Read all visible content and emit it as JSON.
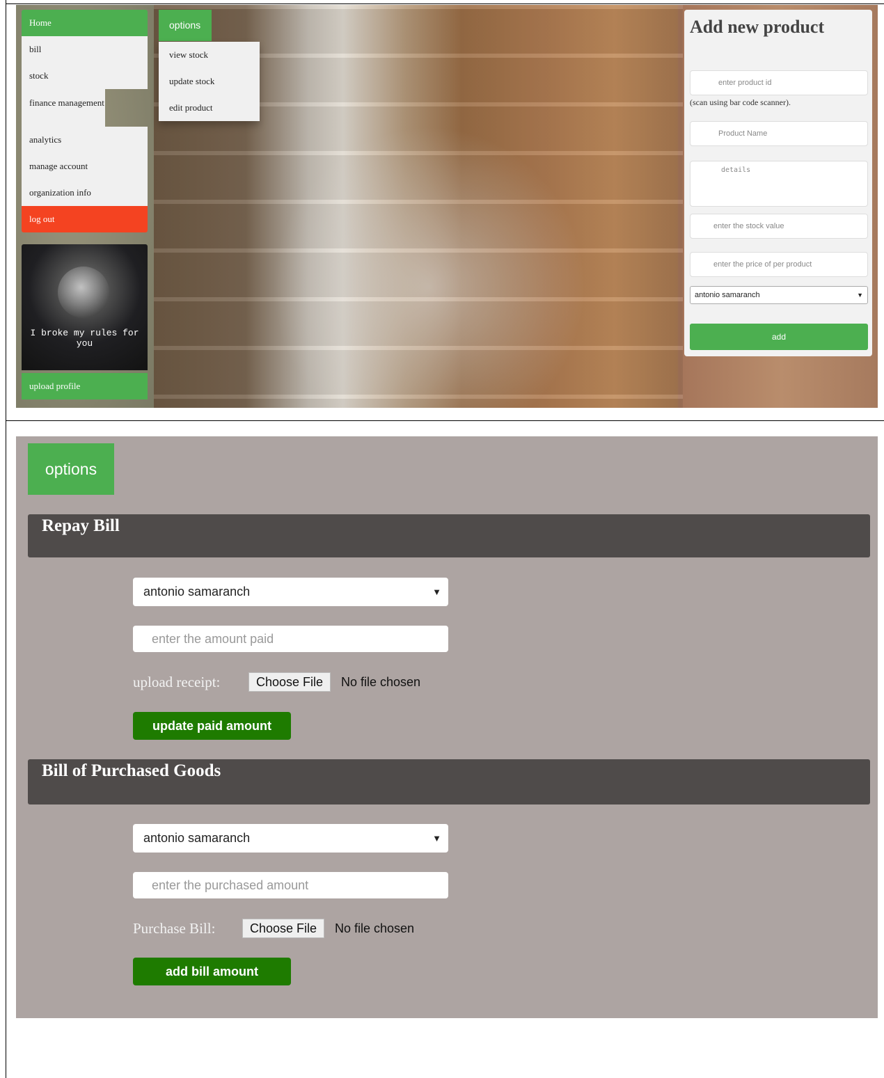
{
  "sidebar": {
    "items": [
      "Home",
      "bill",
      "stock",
      "finance management",
      "analytics",
      "manage account",
      "organization info",
      "log out"
    ],
    "profile_quote": "I broke my rules for you",
    "upload_label": "upload profile"
  },
  "options_menu": {
    "tab_label": "options",
    "items": [
      "view stock",
      "update stock",
      "edit product"
    ]
  },
  "add_product": {
    "title": "Add new product",
    "product_id_placeholder": "enter product id",
    "scan_hint": "(scan using bar code scanner).",
    "product_name_placeholder": "Product Name",
    "details_placeholder": "details",
    "stock_placeholder": "enter the stock value",
    "price_placeholder": "enter the price of per product",
    "selected_vendor": "antonio samaranch",
    "add_label": "add"
  },
  "finance": {
    "options_label": "options",
    "repay": {
      "title": "Repay Bill",
      "selected": "antonio samaranch",
      "amount_placeholder": "enter the amount paid",
      "upload_label": "upload receipt:",
      "file_button": "Choose File",
      "file_status": "No file chosen",
      "submit_label": "update paid amount"
    },
    "purchase": {
      "title": "Bill of Purchased Goods",
      "selected": "antonio samaranch",
      "amount_placeholder": "enter the purchased amount",
      "upload_label": "Purchase Bill:",
      "file_button": "Choose File",
      "file_status": "No file chosen",
      "submit_label": "add bill amount"
    }
  },
  "colors": {
    "primary_green": "#4caf50",
    "logout_red": "#f44321",
    "dark_green": "#1e7b00",
    "section_header": "#4f4b4a",
    "panel_bg": "#ada4a2"
  }
}
